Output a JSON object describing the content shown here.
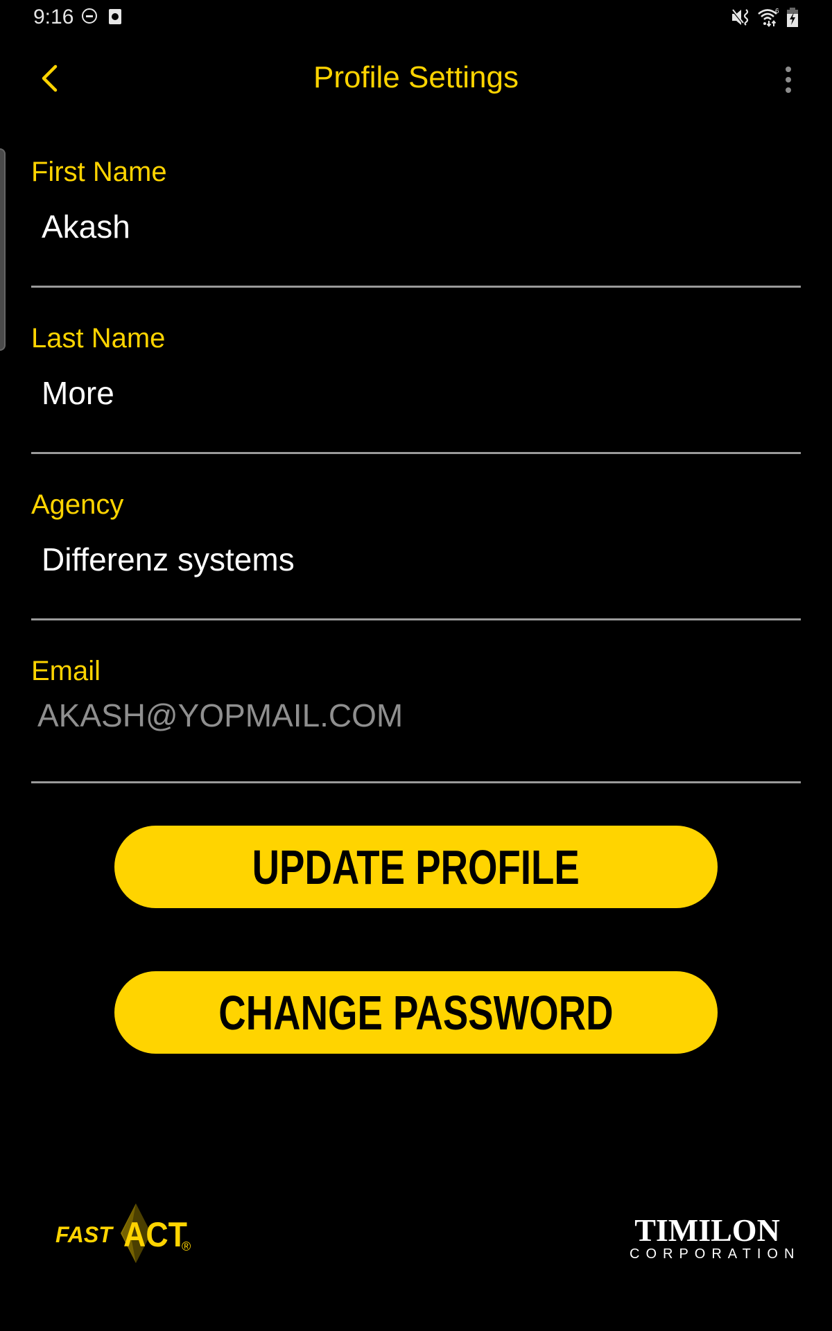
{
  "status_bar": {
    "time": "9:16",
    "left_icons": [
      "do-not-disturb-icon",
      "clock-app-icon"
    ],
    "right_icons": [
      "vibrate-mute-icon",
      "wifi-icon",
      "battery-charging-icon"
    ],
    "wifi_badge": "6"
  },
  "header": {
    "title": "Profile Settings",
    "back_icon": "chevron-left-icon",
    "more_icon": "more-vertical-icon"
  },
  "form": {
    "fields": [
      {
        "label": "First Name",
        "value": "Akash"
      },
      {
        "label": "Last Name",
        "value": "More"
      },
      {
        "label": "Agency",
        "value": "Differenz systems"
      },
      {
        "label": "Email",
        "value": "AKASH@YOPMAIL.COM",
        "readonly": true
      }
    ]
  },
  "buttons": {
    "update_profile": "UPDATE PROFILE",
    "change_password": "CHANGE PASSWORD"
  },
  "footer": {
    "left_logo": {
      "fast": "FAST",
      "act": "ACT",
      "registered": "®"
    },
    "right_logo": {
      "name": "TIMILON",
      "sub": "CORPORATION"
    }
  },
  "colors": {
    "accent": "#ffd400",
    "background": "#000000",
    "divider": "#9a9a9a",
    "readonly_text": "#8f8f8f"
  }
}
